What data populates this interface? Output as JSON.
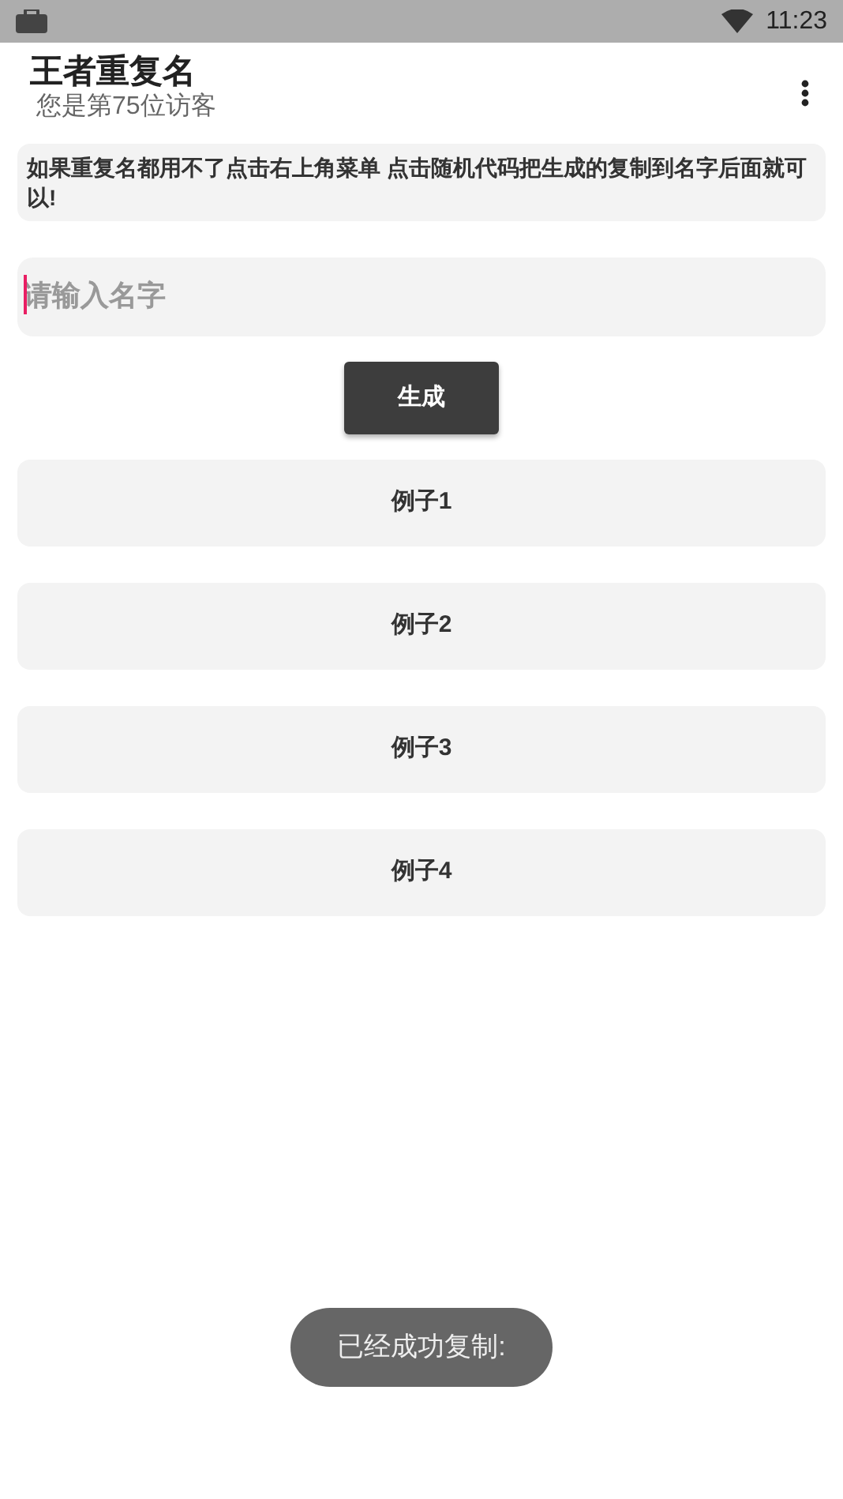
{
  "status_bar": {
    "time": "11:23"
  },
  "app_bar": {
    "title": "王者重复名",
    "subtitle": "您是第75位访客"
  },
  "notice": "如果重复名都用不了点击右上角菜单 点击随机代码把生成的复制到名字后面就可以!",
  "name_input": {
    "placeholder": "请输入名字",
    "focused": true
  },
  "generate_button": "生成",
  "examples": [
    "例子1",
    "例子2",
    "例子3",
    "例子4"
  ],
  "toast": "已经成功复制:"
}
